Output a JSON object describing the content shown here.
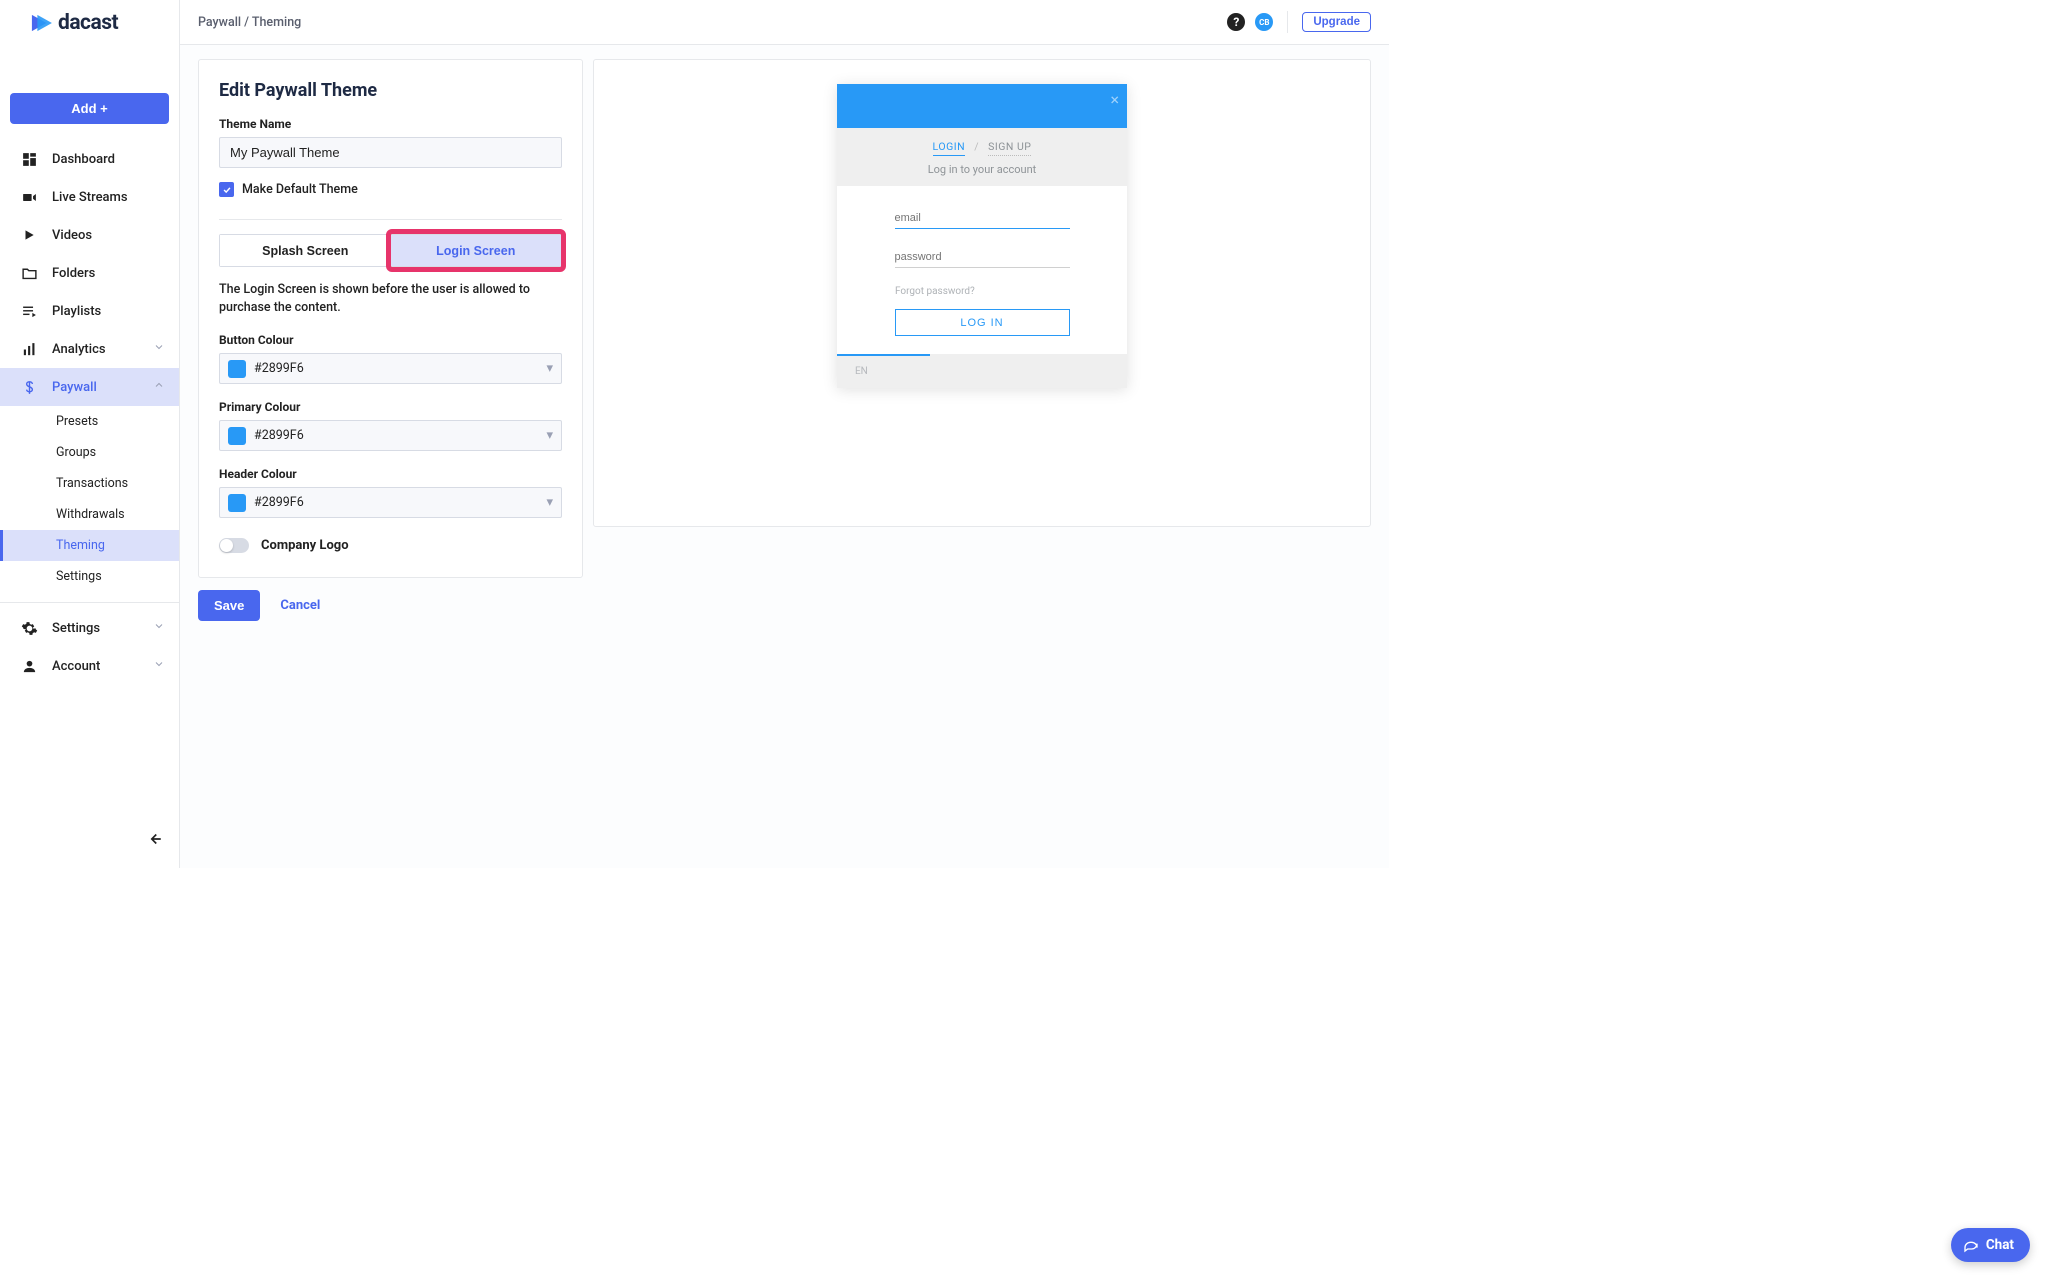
{
  "brand": {
    "name": "dacast"
  },
  "topbar": {
    "breadcrumb": "Paywall  /  Theming",
    "avatar_initials": "CB",
    "upgrade_label": "Upgrade"
  },
  "add_button": "Add +",
  "nav": {
    "dashboard": "Dashboard",
    "live_streams": "Live Streams",
    "videos": "Videos",
    "folders": "Folders",
    "playlists": "Playlists",
    "analytics": "Analytics",
    "paywall": "Paywall",
    "paywall_children": {
      "presets": "Presets",
      "groups": "Groups",
      "transactions": "Transactions",
      "withdrawals": "Withdrawals",
      "theming": "Theming",
      "settings": "Settings"
    },
    "settings": "Settings",
    "account": "Account"
  },
  "edit_card": {
    "title": "Edit Paywall Theme",
    "theme_name_label": "Theme Name",
    "theme_name_value": "My Paywall Theme",
    "make_default_label": "Make Default Theme",
    "tabs": {
      "splash": "Splash Screen",
      "login": "Login Screen"
    },
    "help_text": "The Login Screen is shown before the user is allowed to purchase the content.",
    "button_colour_label": "Button Colour",
    "primary_colour_label": "Primary Colour",
    "header_colour_label": "Header Colour",
    "colour_value": "#2899F6",
    "company_logo_label": "Company Logo"
  },
  "actions": {
    "save": "Save",
    "cancel": "Cancel"
  },
  "preview": {
    "login_tab": "LOGIN",
    "signup_tab": "SIGN UP",
    "subtitle": "Log in to your account",
    "email_ph": "email",
    "password_ph": "password",
    "forgot": "Forgot password?",
    "login_btn": "LOG IN",
    "lang": "EN"
  },
  "chat": {
    "label": "Chat"
  }
}
